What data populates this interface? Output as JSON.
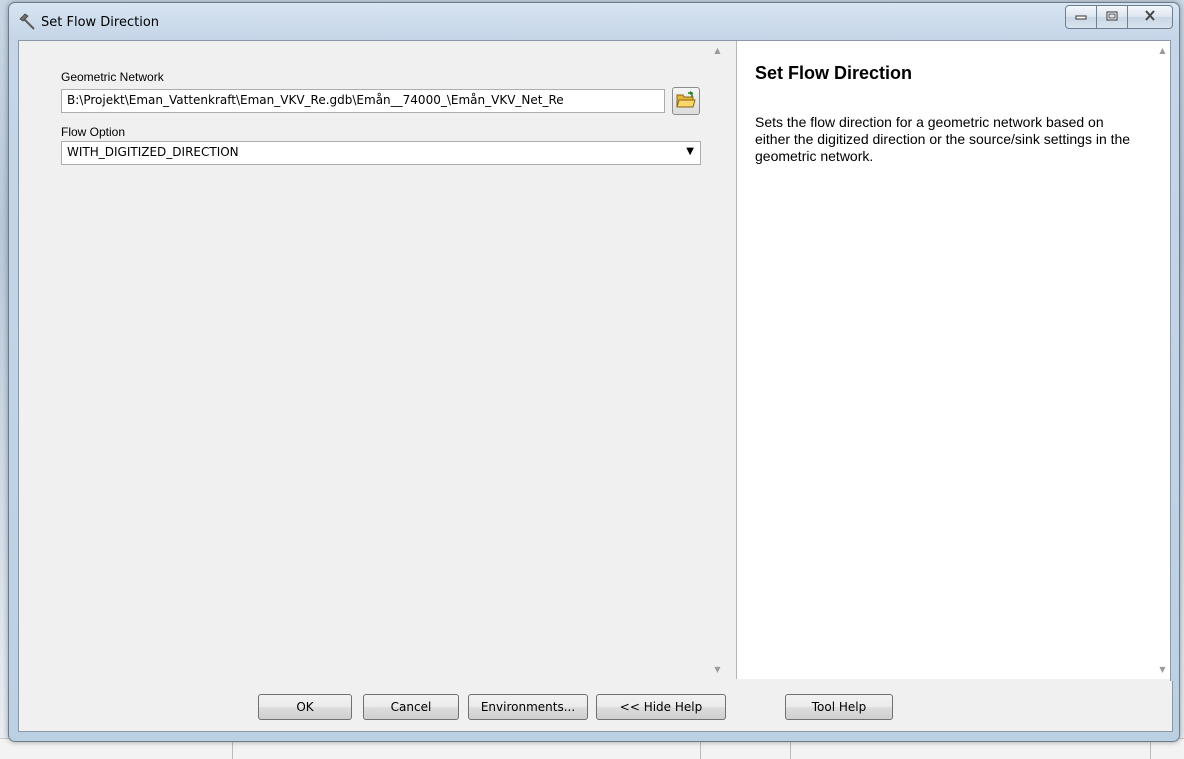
{
  "window": {
    "title": "Set Flow Direction"
  },
  "params": {
    "geometric_network": {
      "label": "Geometric Network",
      "value": "B:\\Projekt\\Eman_Vattenkraft\\Eman_VKV_Re.gdb\\Emån__74000_\\Emån_VKV_Net_Re"
    },
    "flow_option": {
      "label": "Flow Option",
      "selected": "WITH_DIGITIZED_DIRECTION"
    }
  },
  "help": {
    "title": "Set Flow Direction",
    "body": "Sets the flow direction for a geometric network based on either the digitized direction or the source/sink settings in the geometric network."
  },
  "buttons": {
    "ok": "OK",
    "cancel": "Cancel",
    "environments": "Environments...",
    "hide_help": "<< Hide Help",
    "tool_help": "Tool Help"
  },
  "icons": {
    "title": "hammer-icon",
    "browse": "folder-open-icon",
    "minimize": "minimize-icon",
    "maximize": "maximize-icon",
    "close": "close-icon"
  }
}
